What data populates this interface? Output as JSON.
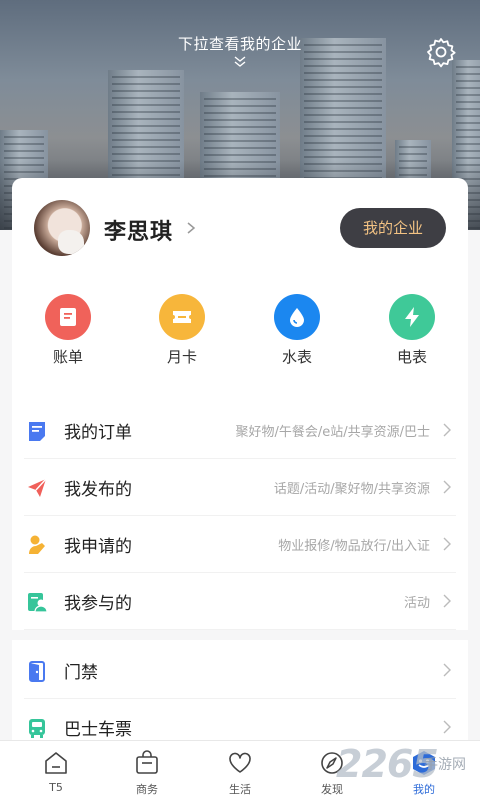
{
  "hero": {
    "hint": "下拉查看我的企业"
  },
  "profile": {
    "name": "李思琪",
    "enterprise_button": "我的企业"
  },
  "quick_actions": [
    {
      "label": "账单",
      "color": "#f0625a",
      "icon": "bill-icon"
    },
    {
      "label": "月卡",
      "color": "#f7b63b",
      "icon": "ticket-icon"
    },
    {
      "label": "水表",
      "color": "#1b87f0",
      "icon": "water-drop-icon"
    },
    {
      "label": "电表",
      "color": "#3fc998",
      "icon": "lightning-icon"
    }
  ],
  "menu": [
    {
      "label": "我的订单",
      "sub": "聚好物/午餐会/e站/共享资源/巴士",
      "icon": "order-icon",
      "color": "#4a79f0"
    },
    {
      "label": "我发布的",
      "sub": "话题/活动/聚好物/共享资源",
      "icon": "send-icon",
      "color": "#f0605a"
    },
    {
      "label": "我申请的",
      "sub": "物业报修/物品放行/出入证",
      "icon": "apply-icon",
      "color": "#f5b234"
    },
    {
      "label": "我参与的",
      "sub": "活动",
      "icon": "participate-icon",
      "color": "#36c59a"
    },
    {
      "label": "门禁",
      "sub": "",
      "icon": "door-icon",
      "color": "#4a79f0"
    },
    {
      "label": "巴士车票",
      "sub": "",
      "icon": "bus-icon",
      "color": "#36c59a"
    }
  ],
  "tabs": [
    {
      "label": "T5",
      "icon": "home-icon"
    },
    {
      "label": "商务",
      "icon": "bag-icon"
    },
    {
      "label": "生活",
      "icon": "heart-icon"
    },
    {
      "label": "发现",
      "icon": "compass-icon"
    },
    {
      "label": "我的",
      "icon": "profile-icon",
      "active": true
    }
  ],
  "watermark": {
    "text": "2265",
    "site": "手游网"
  }
}
